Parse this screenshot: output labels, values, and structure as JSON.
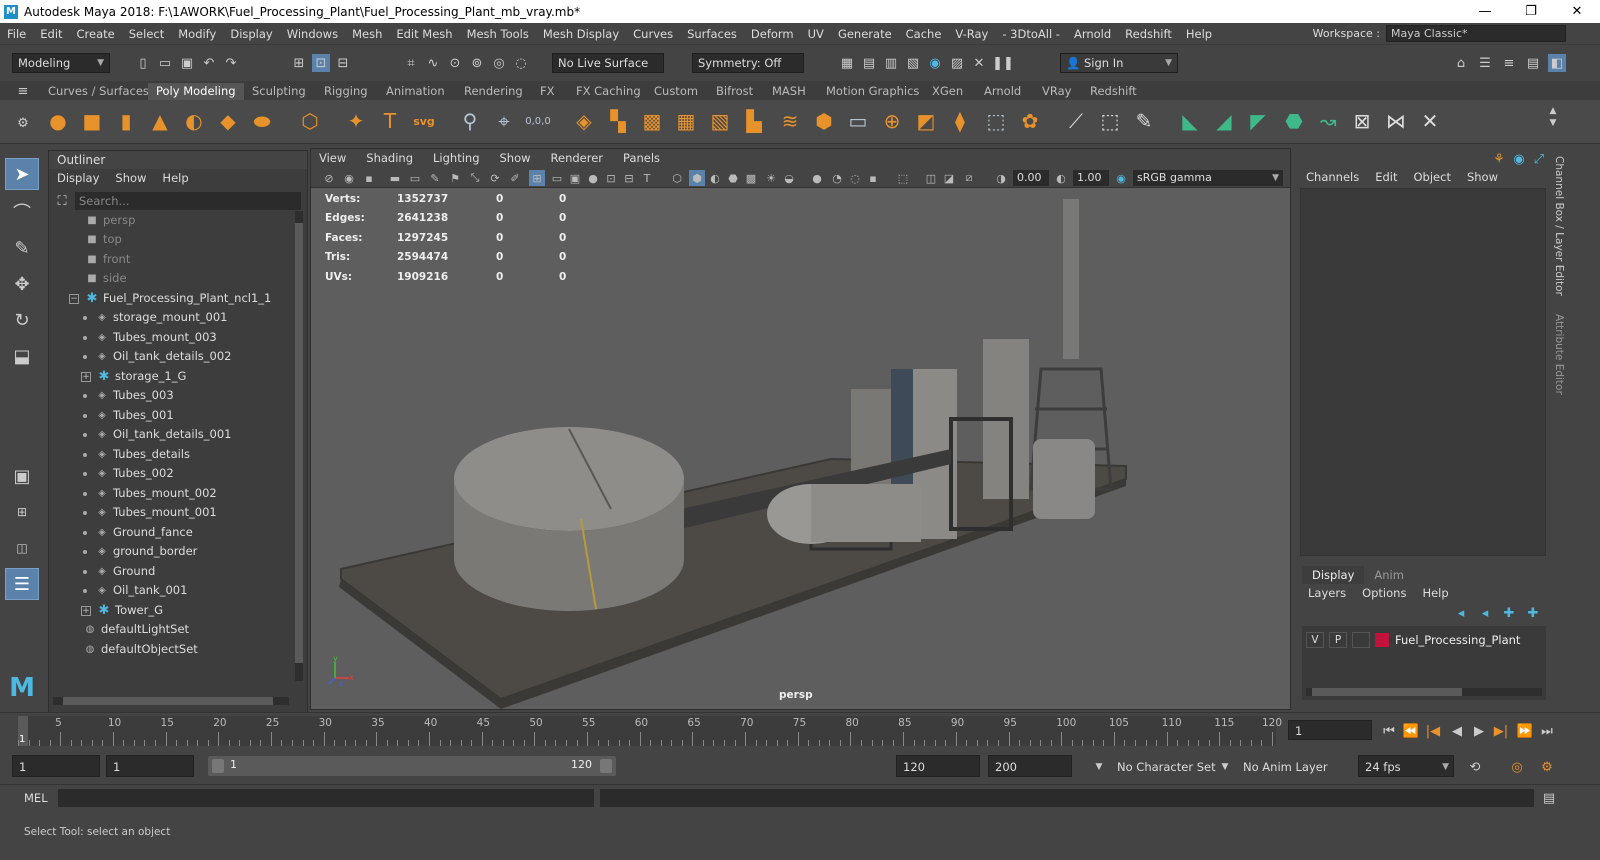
{
  "window": {
    "title": "Autodesk Maya 2018: F:\\1AWORK\\Fuel_Processing_Plant\\Fuel_Processing_Plant_mb_vray.mb*",
    "logo_letter": "M",
    "minimize": "—",
    "maximize": "❐",
    "close": "✕"
  },
  "menubar": {
    "items": [
      "File",
      "Edit",
      "Create",
      "Select",
      "Modify",
      "Display",
      "Windows",
      "Mesh",
      "Edit Mesh",
      "Mesh Tools",
      "Mesh Display",
      "Curves",
      "Surfaces",
      "Deform",
      "UV",
      "Generate",
      "Cache",
      "V-Ray",
      "- 3DtoAll -",
      "Arnold",
      "Redshift",
      "Help"
    ],
    "workspace_label": "Workspace :",
    "workspace_value": "Maya Classic*"
  },
  "statusline": {
    "mode": "Modeling",
    "live_surface": "No Live Surface",
    "symmetry": "Symmetry: Off",
    "sign_in": "Sign In"
  },
  "shelf": {
    "tabs": [
      "Curves / Surfaces",
      "Poly Modeling",
      "Sculpting",
      "Rigging",
      "Animation",
      "Rendering",
      "FX",
      "FX Caching",
      "Custom",
      "Bifrost",
      "MASH",
      "Motion Graphics",
      "XGen",
      "Arnold",
      "VRay",
      "Redshift"
    ],
    "active_tab": "Poly Modeling",
    "svg_label": "svg",
    "coords_label": "0,0,0"
  },
  "outliner": {
    "title": "Outliner",
    "menu": [
      "Display",
      "Show",
      "Help"
    ],
    "search_placeholder": "Search...",
    "items": [
      {
        "label": "persp",
        "type": "camera",
        "dim": true
      },
      {
        "label": "top",
        "type": "camera",
        "dim": true
      },
      {
        "label": "front",
        "type": "camera",
        "dim": true
      },
      {
        "label": "side",
        "type": "camera",
        "dim": true
      },
      {
        "label": "Fuel_Processing_Plant_ncl1_1",
        "type": "group",
        "expanded": true
      },
      {
        "label": "storage_mount_001",
        "type": "mesh"
      },
      {
        "label": "Tubes_mount_003",
        "type": "mesh"
      },
      {
        "label": "Oil_tank_details_002",
        "type": "mesh"
      },
      {
        "label": "storage_1_G",
        "type": "group",
        "collapsed": true
      },
      {
        "label": "Tubes_003",
        "type": "mesh"
      },
      {
        "label": "Tubes_001",
        "type": "mesh"
      },
      {
        "label": "Oil_tank_details_001",
        "type": "mesh"
      },
      {
        "label": "Tubes_details",
        "type": "mesh"
      },
      {
        "label": "Tubes_002",
        "type": "mesh"
      },
      {
        "label": "Tubes_mount_002",
        "type": "mesh"
      },
      {
        "label": "Tubes_mount_001",
        "type": "mesh"
      },
      {
        "label": "Ground_fance",
        "type": "mesh"
      },
      {
        "label": "ground_border",
        "type": "mesh"
      },
      {
        "label": "Ground",
        "type": "mesh"
      },
      {
        "label": "Oil_tank_001",
        "type": "mesh"
      },
      {
        "label": "Tower_G",
        "type": "group",
        "collapsed": true
      },
      {
        "label": "defaultLightSet",
        "type": "set"
      },
      {
        "label": "defaultObjectSet",
        "type": "set"
      }
    ]
  },
  "viewport": {
    "menu": [
      "View",
      "Shading",
      "Lighting",
      "Show",
      "Renderer",
      "Panels"
    ],
    "exposure": "0.00",
    "gamma": "1.00",
    "color_space": "sRGB gamma",
    "camera": "persp",
    "hud": [
      {
        "label": "Verts:",
        "a": "1352737",
        "b": "0",
        "c": "0"
      },
      {
        "label": "Edges:",
        "a": "2641238",
        "b": "0",
        "c": "0"
      },
      {
        "label": "Faces:",
        "a": "1297245",
        "b": "0",
        "c": "0"
      },
      {
        "label": "Tris:",
        "a": "2594474",
        "b": "0",
        "c": "0"
      },
      {
        "label": "UVs:",
        "a": "1909216",
        "b": "0",
        "c": "0"
      }
    ],
    "axis_x": "x",
    "axis_y": "y",
    "axis_z": "z"
  },
  "channelbox": {
    "menu": [
      "Channels",
      "Edit",
      "Object",
      "Show"
    ],
    "layer_tabs": [
      "Display",
      "Anim"
    ],
    "active_layer_tab": "Display",
    "layer_menu": [
      "Layers",
      "Options",
      "Help"
    ],
    "layer": {
      "v": "V",
      "p": "P",
      "name": "Fuel_Processing_Plant",
      "color": "#c0143c"
    },
    "side_tab_1": "Channel Box / Layer Editor",
    "side_tab_2": "Attribute Editor"
  },
  "timeline": {
    "start": 1,
    "end": 120,
    "current": "1",
    "labels": [
      "5",
      "10",
      "15",
      "20",
      "25",
      "30",
      "35",
      "40",
      "45",
      "50",
      "55",
      "60",
      "65",
      "70",
      "75",
      "80",
      "85",
      "90",
      "95",
      "100",
      "105",
      "110",
      "115",
      "120"
    ],
    "current_frame_field": "1"
  },
  "range": {
    "start_field": "1",
    "anim_start_field": "1",
    "slider_start": "1",
    "slider_end": "120",
    "end_field": "120",
    "anim_end_field": "200",
    "character_set": "No Character Set",
    "anim_layer": "No Anim Layer",
    "fps": "24 fps"
  },
  "mel": {
    "label": "MEL"
  },
  "help_line": "Select Tool: select an object",
  "colors": {
    "accent": "#5b82aa",
    "shelf_orange": "#e8922b",
    "shelf_green": "#3fb88a",
    "group_icon": "#4fb8e0"
  }
}
